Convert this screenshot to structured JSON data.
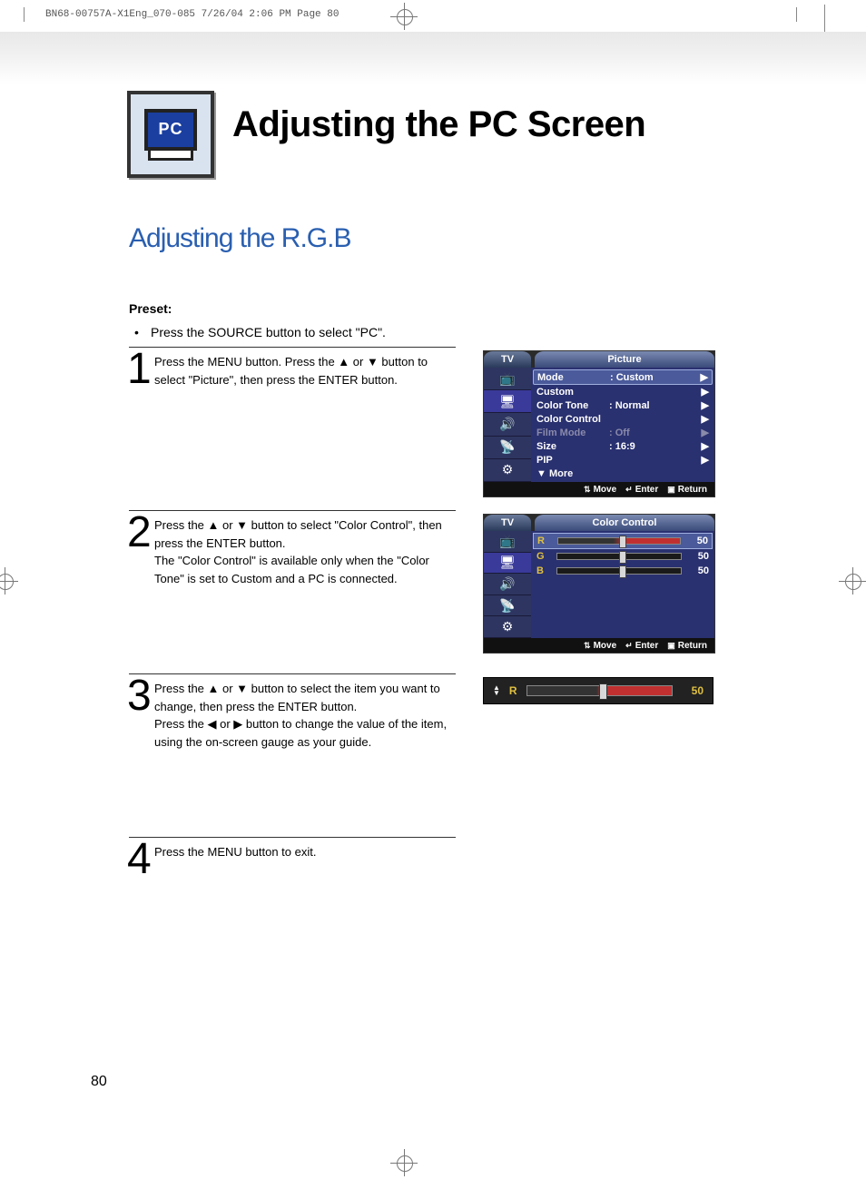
{
  "print_header": "BN68-00757A-X1Eng_070-085  7/26/04  2:06 PM  Page 80",
  "icon_text": "PC",
  "title": "Adjusting the PC Screen",
  "subtitle": "Adjusting the R.G.B",
  "preset_label": "Preset:",
  "preset_text": "Press the SOURCE button to select \"PC\".",
  "steps": {
    "s1": {
      "n": "1",
      "text": "Press the MENU button. Press the ▲ or ▼ button to select \"Picture\", then press the ENTER button."
    },
    "s2": {
      "n": "2",
      "text": "Press the ▲ or ▼ button to select \"Color Control\", then press the ENTER button.\nThe \"Color Control\" is available only when the \"Color Tone\" is set to Custom and a PC is connected."
    },
    "s3": {
      "n": "3",
      "text": "Press the ▲ or ▼ button to select the item you want to change, then press the ENTER button.\nPress the ◀ or ▶ button to change the value of the item, using the on-screen gauge as your guide."
    },
    "s4": {
      "n": "4",
      "text": "Press the MENU button to exit."
    }
  },
  "osd1": {
    "tv": "TV",
    "title": "Picture",
    "rows": [
      {
        "label": "Mode",
        "value": ":  Custom",
        "arrow": "▶",
        "selected": true
      },
      {
        "label": "Custom",
        "value": "",
        "arrow": "▶"
      },
      {
        "label": "Color Tone",
        "value": ":  Normal",
        "arrow": "▶"
      },
      {
        "label": "Color Control",
        "value": "",
        "arrow": "▶"
      },
      {
        "label": "Film Mode",
        "value": ":  Off",
        "arrow": "▶",
        "dim": true
      },
      {
        "label": "Size",
        "value": ":  16:9",
        "arrow": "▶"
      },
      {
        "label": "PIP",
        "value": "",
        "arrow": "▶"
      },
      {
        "label": "▼ More",
        "value": "",
        "arrow": ""
      }
    ],
    "footer": {
      "move": "Move",
      "enter": "Enter",
      "ret": "Return"
    }
  },
  "osd2": {
    "tv": "TV",
    "title": "Color Control",
    "sliders": [
      {
        "ch": "R",
        "val": "50",
        "selected": true,
        "pos": 50
      },
      {
        "ch": "G",
        "val": "50",
        "pos": 50
      },
      {
        "ch": "B",
        "val": "50",
        "pos": 50
      }
    ],
    "footer": {
      "move": "Move",
      "enter": "Enter",
      "ret": "Return"
    }
  },
  "gauge": {
    "ch": "R",
    "val": "50",
    "pos": 50
  },
  "page_number": "80"
}
